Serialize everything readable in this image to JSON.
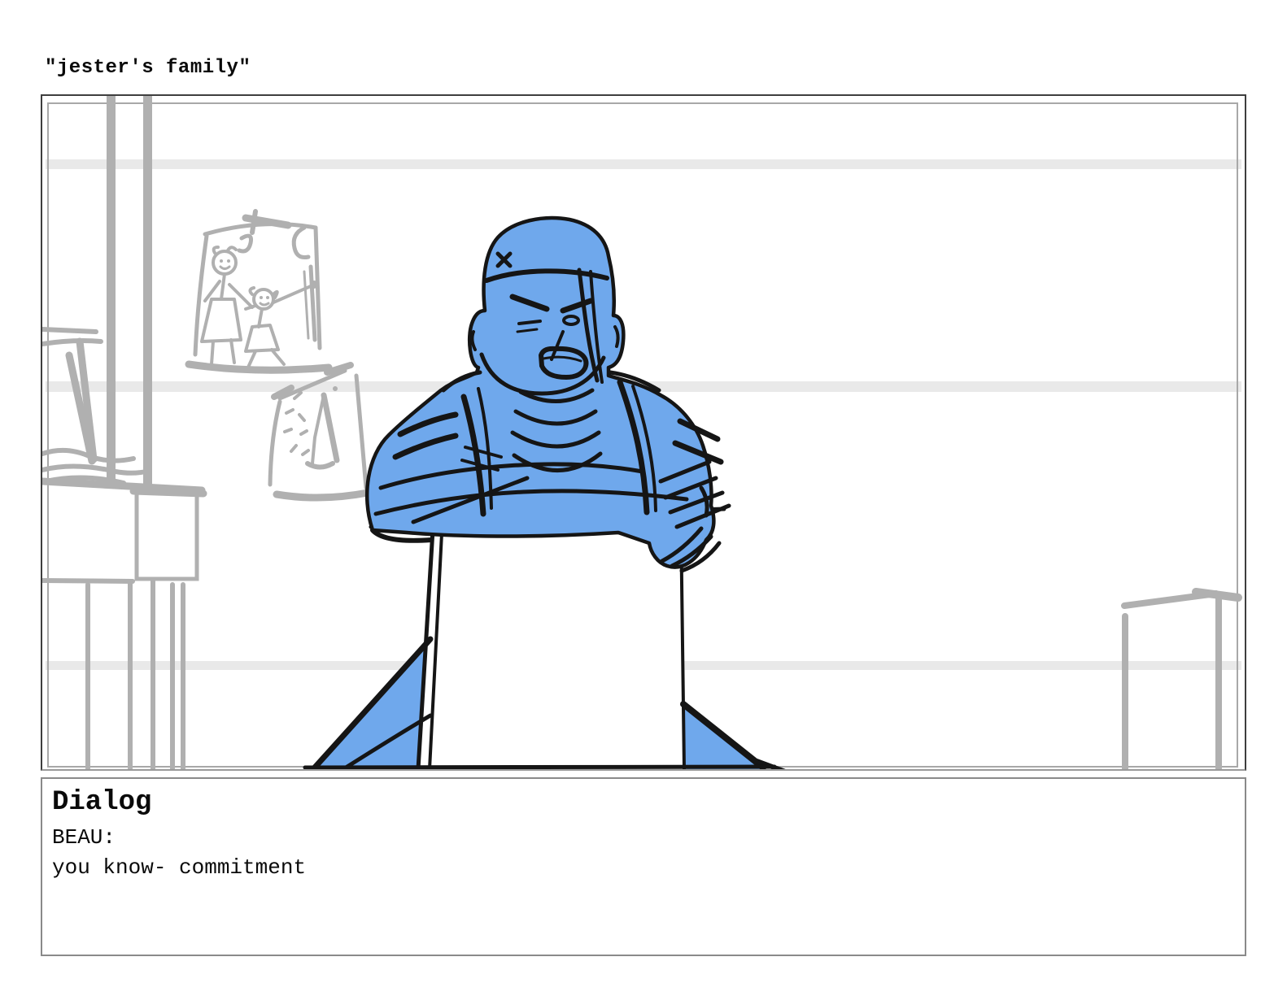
{
  "title": "\"jester's family\"",
  "dialog": {
    "heading": "Dialog",
    "speaker": "BEAU:",
    "line": "you know- commitment"
  },
  "colors": {
    "figure_blue": "#6FA8EC",
    "ink": "#151515",
    "sketch_gray": "#b0b0b0",
    "wall_band": "#e9e9e9",
    "panel_border": "#3e3e3e",
    "panel_border_bottom": "#9a9a9a",
    "dialog_border": "#8a8a8a",
    "inner_frame": "#a8a8a8"
  }
}
